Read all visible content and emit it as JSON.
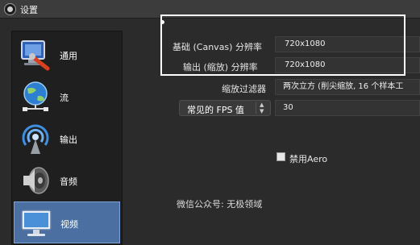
{
  "window": {
    "title": "设置"
  },
  "sidebar": {
    "items": [
      {
        "label": "通用",
        "icon": "wrench-screen-icon",
        "active": false
      },
      {
        "label": "流",
        "icon": "globe-network-icon",
        "active": false
      },
      {
        "label": "输出",
        "icon": "broadcast-antenna-icon",
        "active": false
      },
      {
        "label": "音频",
        "icon": "speaker-icon",
        "active": false
      },
      {
        "label": "视频",
        "icon": "monitor-icon",
        "active": true
      }
    ]
  },
  "video": {
    "base_resolution": {
      "label": "基础 (Canvas) 分辨率",
      "value": "720x1080"
    },
    "output_resolution": {
      "label": "输出 (缩放) 分辨率",
      "value": "720x1080"
    },
    "downscale_filter": {
      "label": "缩放过滤器",
      "value": "两次立方 (削尖缩放, 16 个样本工"
    },
    "fps": {
      "label": "常见的 FPS 值",
      "value": "30"
    },
    "disable_aero": {
      "label": "禁用Aero",
      "checked": false
    }
  },
  "watermark": "微信公众号: 无极领域",
  "colors": {
    "background": "#2b2b2b",
    "sidebar_bg": "#1f1f1f",
    "selected_item": "#4a6fa0",
    "highlight_frame": "#ffffff"
  }
}
